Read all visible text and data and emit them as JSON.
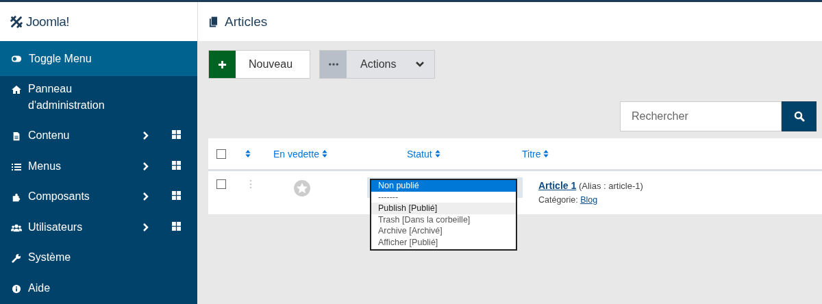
{
  "brand": {
    "name": "Joomla!"
  },
  "page": {
    "title": "Articles"
  },
  "sidebar": {
    "toggle": {
      "label": "Toggle Menu"
    },
    "items": [
      {
        "kind": "home",
        "label": "Panneau d'administration",
        "has_submenu": false
      },
      {
        "kind": "file",
        "label": "Contenu",
        "has_submenu": true
      },
      {
        "kind": "list",
        "label": "Menus",
        "has_submenu": true
      },
      {
        "kind": "puzzle",
        "label": "Composants",
        "has_submenu": true
      },
      {
        "kind": "users",
        "label": "Utilisateurs",
        "has_submenu": true
      },
      {
        "kind": "wrench",
        "label": "Système",
        "has_submenu": false
      },
      {
        "kind": "info",
        "label": "Aide",
        "has_submenu": false
      }
    ]
  },
  "toolbar": {
    "new_button": "Nouveau",
    "actions_button": "Actions"
  },
  "search": {
    "placeholder": "Rechercher"
  },
  "table": {
    "select_all_checked": false,
    "columns": [
      {
        "label": "En vedette"
      },
      {
        "label": "Statut"
      },
      {
        "label": "Titre"
      }
    ],
    "rows": [
      {
        "checked": false,
        "featured": false,
        "title": "Article 1",
        "alias": "(Alias : article-1)",
        "category_label": "Catégorie:",
        "category": "Blog",
        "status_options": [
          {
            "label": "Non publié",
            "selected": true,
            "hovered": false
          },
          {
            "label": "-------",
            "selected": false,
            "hovered": false
          },
          {
            "label": "Publish [Publié]",
            "selected": false,
            "hovered": true
          },
          {
            "label": "Trash [Dans la corbeille]",
            "selected": false,
            "hovered": false
          },
          {
            "label": "Archive [Archivé]",
            "selected": false,
            "hovered": false
          },
          {
            "label": "Afficher [Publié]",
            "selected": false,
            "hovered": false
          }
        ]
      }
    ]
  }
}
